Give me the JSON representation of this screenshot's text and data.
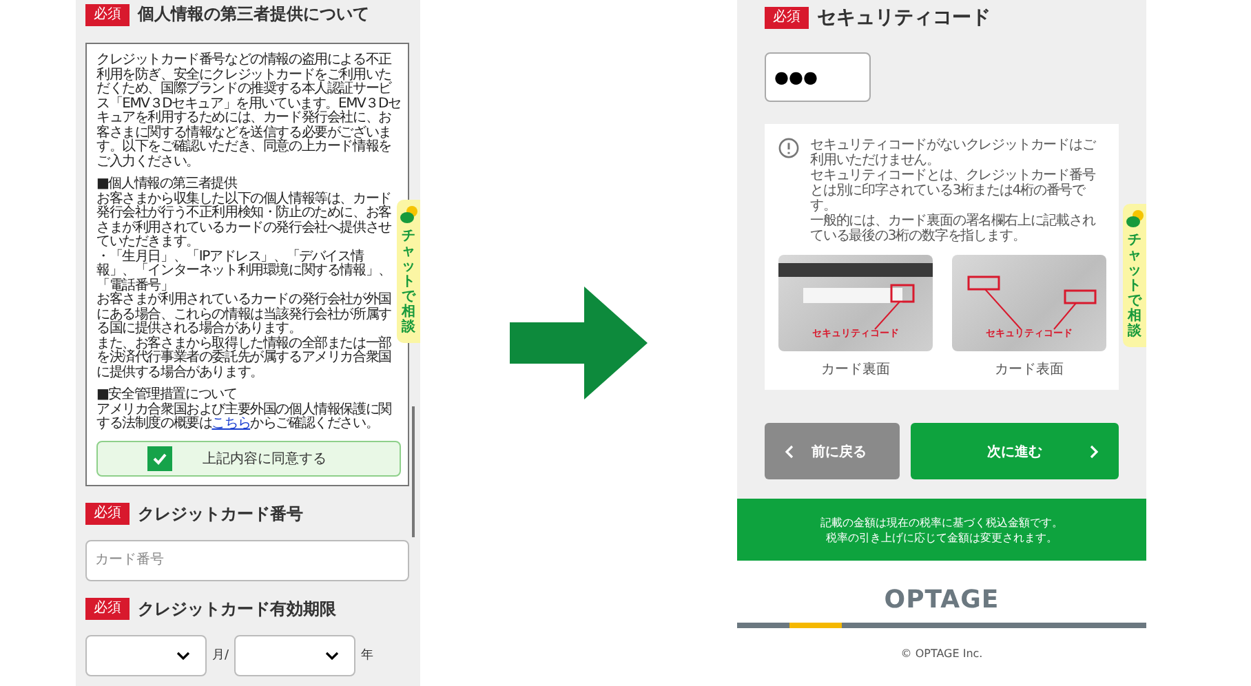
{
  "left_screen": {
    "consent_heading": {
      "badge": "必須",
      "title": "個人情報の第三者提供について"
    },
    "consent_blocks": [
      {
        "lines": [
          "クレジットカード番号などの情報の盗用による不正利用を防ぎ、安全にクレジットカードをご利用いただくため、国際ブランドの推奨する本人認証サービス「EMV３Dセキュア」を用いています。EMV３Dセキュアを利用するためには、カード発行会社に、お客さまに関する情報などを送信する必要がございます。以下をご確認いただき、同意の上カード情報をご入力ください。"
        ]
      },
      {
        "lines": [
          "■個人情報の第三者提供",
          "お客さまから収集した以下の個人情報等は、カード発行会社が行う不正利用検知・防止のために、お客さまが利用されているカードの発行会社へ提供させていただきます。",
          "・「生月日」、「IPアドレス」、「デバイス情報」、「インターネット利用環境に関する情報」、「電話番号」",
          "お客さまが利用されているカードの発行会社が外国にある場合、これらの情報は当該発行会社が所属する国に提供される場合があります。",
          "また、お客さまから取得した情報の全部または一部を決済代行事業者の委託先が属するアメリカ合衆国に提供する場合があります。"
        ]
      },
      {
        "lines": [
          "■安全管理措置について"
        ]
      }
    ],
    "policy_link": {
      "before": "アメリカ合衆国および主要外国の個人情報保護に関する法制度の概要は",
      "link": "こちら",
      "after": "からご確認ください。"
    },
    "agree": {
      "label": "上記内容に同意する",
      "checked": true
    },
    "card_number": {
      "badge": "必須",
      "label": "クレジットカード番号",
      "placeholder": "カード番号"
    },
    "expiry": {
      "badge": "必須",
      "label": "クレジットカード有効期限",
      "month_unit": "月/",
      "year_unit": "年"
    },
    "chat_tab": {
      "label": "チャットで相談"
    }
  },
  "right_screen": {
    "security_code": {
      "badge": "必須",
      "label": "セキュリティコード",
      "value": "●●●"
    },
    "notice": [
      "セキュリティコードがないクレジットカードはご利用いただけません。",
      "セキュリティコードとは、クレジットカード番号とは別に印字されている3桁または4桁の番号です。",
      "一般的には、カード裏面の署名欄右上に記載されている最後の3桁の数字を指します。"
    ],
    "cards": [
      {
        "kind": "back",
        "marker": "セキュリティコード",
        "caption": "カード裏面"
      },
      {
        "kind": "front",
        "marker": "セキュリティコード",
        "caption": "カード表面"
      }
    ],
    "buttons": [
      {
        "kind": "back",
        "label": "前に戻る"
      },
      {
        "kind": "next",
        "label": "次に進む"
      }
    ],
    "tax_note": [
      "記載の金額は現在の税率に基づく税込金額です。",
      "税率の引き上げに応じて金額は変更されます。"
    ],
    "logo": "OPTAGE",
    "copyright": "© OPTAGE Inc.",
    "chat_tab": {
      "label": "チャットで相談"
    }
  }
}
